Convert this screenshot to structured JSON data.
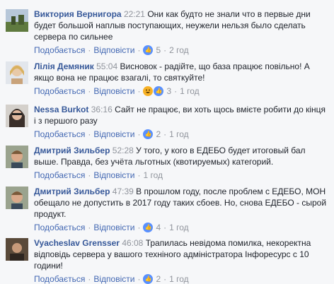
{
  "comments": [
    {
      "author": "Виктория Вернигора",
      "time": "22:21",
      "text": "Они как будто не знали что в первые дни будет большой наплыв поступающих, неужели нельзя было сделать сервера по сильнее",
      "like_label": "Подобається",
      "reply_label": "Відповісти",
      "reaction_count": "5",
      "age": "2 год",
      "reaction_types": [
        "like-icon"
      ]
    },
    {
      "author": "Лілія Демяник",
      "time": "55:04",
      "text": "Висновок - радійте, що база працює повільно! А якщо вона не працює взагалі, то святкуйте!",
      "like_label": "Подобається",
      "reply_label": "Відповісти",
      "reaction_count": "3",
      "age": "1 год",
      "reaction_types": [
        "haha-icon",
        "like-icon"
      ]
    },
    {
      "author": "Nessa Burkot",
      "time": "36:16",
      "text": "Сайт не працює, ви хоть щось вмієте робити до кінця і з першого разу",
      "like_label": "Подобається",
      "reply_label": "Відповісти",
      "reaction_count": "2",
      "age": "1 год",
      "reaction_types": [
        "like-icon"
      ]
    },
    {
      "author": "Дмитрий Зильбер",
      "time": "52:28",
      "text": "У того, у кого в ЕДЕБО будет итоговый бал выше. Правда, без учёта льготных (квотируемых) категорий.",
      "like_label": "Подобається",
      "reply_label": "Відповісти",
      "reaction_count": "",
      "age": "1 год",
      "reaction_types": []
    },
    {
      "author": "Дмитрий Зильбер",
      "time": "47:39",
      "text": "В прошлом году, после проблем с ЕДЕБО, МОН обещало не допустить в 2017 году таких сбоев. Но, снова ЕДЕБО - сырой продукт.",
      "like_label": "Подобається",
      "reply_label": "Відповісти",
      "reaction_count": "4",
      "age": "1 год",
      "reaction_types": [
        "like-icon"
      ]
    },
    {
      "author": "Vyacheslav Grensser",
      "time": "46:08",
      "text": "Трапилась невідома помилка, некоректна відповідь сервера у вашого технiного адміністратора Інфоресурс с 10 години!",
      "like_label": "Подобається",
      "reply_label": "Відповісти",
      "reaction_count": "2",
      "age": "1 год",
      "reaction_types": [
        "like-icon"
      ]
    }
  ],
  "colors": {
    "author": "#365899",
    "link": "#4267b2",
    "muted": "#90949c",
    "like": "#5890ff",
    "haha": "#f7b125"
  }
}
